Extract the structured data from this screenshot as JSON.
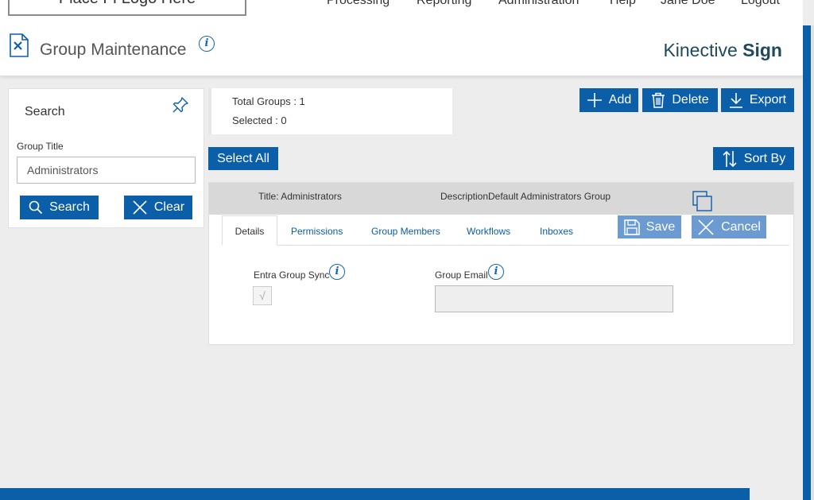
{
  "topbar": {
    "logo_text": "Place FI Logo Here",
    "nav": [
      "Processing",
      "Reporting",
      "Administration",
      "Help",
      "Jane Doe",
      "Logout"
    ]
  },
  "header": {
    "title": "Group Maintenance",
    "info_glyph": "i",
    "brand_light": "Kinective",
    "brand_bold": "Sign"
  },
  "search": {
    "title": "Search",
    "group_title_label": "Group Title",
    "group_title_value": "Administrators",
    "search_button": "Search",
    "clear_button": "Clear"
  },
  "summary": {
    "total_groups": "Total Groups : 1",
    "selected": "Selected : 0"
  },
  "toolbar": {
    "add": "Add",
    "delete": "Delete",
    "export": "Export",
    "select_all": "Select All",
    "sort_by": "Sort By"
  },
  "group": {
    "title_label": "Title: Administrators",
    "description_label": "Description:",
    "description_value": "Default Administrators Group"
  },
  "tabs": [
    "Details",
    "Permissions",
    "Group Members",
    "Workflows",
    "Inboxes"
  ],
  "actions": {
    "save": "Save",
    "cancel": "Cancel"
  },
  "details": {
    "entra_sync_label": "Entra Group Sync",
    "entra_sync_checked": true,
    "check_glyph": "√",
    "group_email_label": "Group Email",
    "group_email_value": ""
  },
  "colors": {
    "primary": "#0b5ea8",
    "primary_disabled": "#6b9bd0",
    "background": "#ededed"
  }
}
